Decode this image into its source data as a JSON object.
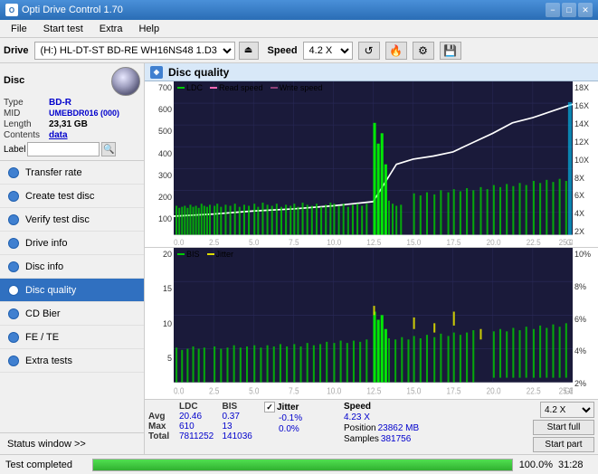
{
  "titleBar": {
    "title": "Opti Drive Control 1.70",
    "minimizeLabel": "−",
    "maximizeLabel": "□",
    "closeLabel": "✕"
  },
  "menuBar": {
    "items": [
      "File",
      "Start test",
      "Extra",
      "Help"
    ]
  },
  "driveBar": {
    "driveLabel": "Drive",
    "driveValue": "(H:) HL-DT-ST BD-RE  WH16NS48 1.D3",
    "speedLabel": "Speed",
    "speedValue": "4.2 X"
  },
  "discPanel": {
    "header": "Disc",
    "type": {
      "key": "Type",
      "val": "BD-R"
    },
    "mid": {
      "key": "MID",
      "val": "UMEBDR016 (000)"
    },
    "length": {
      "key": "Length",
      "val": "23,31 GB"
    },
    "contents": {
      "key": "Contents",
      "val": "data"
    },
    "labelKey": "Label"
  },
  "navItems": [
    {
      "id": "transfer-rate",
      "label": "Transfer rate",
      "active": false
    },
    {
      "id": "create-test-disc",
      "label": "Create test disc",
      "active": false
    },
    {
      "id": "verify-test-disc",
      "label": "Verify test disc",
      "active": false
    },
    {
      "id": "drive-info",
      "label": "Drive info",
      "active": false
    },
    {
      "id": "disc-info",
      "label": "Disc info",
      "active": false
    },
    {
      "id": "disc-quality",
      "label": "Disc quality",
      "active": true
    },
    {
      "id": "cd-bier",
      "label": "CD Bier",
      "active": false
    },
    {
      "id": "fe-te",
      "label": "FE / TE",
      "active": false
    },
    {
      "id": "extra-tests",
      "label": "Extra tests",
      "active": false
    }
  ],
  "statusWindow": "Status window >>",
  "discQuality": {
    "title": "Disc quality",
    "chart1": {
      "legend": [
        {
          "key": "ldc",
          "label": "LDC",
          "color": "#00aa00"
        },
        {
          "key": "readSpeed",
          "label": "Read speed",
          "color": "#ff69b4"
        },
        {
          "key": "writeSpeed",
          "label": "Write speed",
          "color": "#ff69b4"
        }
      ],
      "yLabels": [
        "700",
        "600",
        "500",
        "400",
        "300",
        "200",
        "100"
      ],
      "yLabelsRight": [
        "18X",
        "16X",
        "14X",
        "12X",
        "10X",
        "8X",
        "6X",
        "4X",
        "2X"
      ],
      "xLabels": [
        "0.0",
        "2.5",
        "5.0",
        "7.5",
        "10.0",
        "12.5",
        "15.0",
        "17.5",
        "20.0",
        "22.5",
        "25.0"
      ],
      "xUnit": "GB"
    },
    "chart2": {
      "legend": [
        {
          "key": "bis",
          "label": "BIS",
          "color": "#00aa00"
        },
        {
          "key": "jitter",
          "label": "Jitter",
          "color": "#dddd00"
        }
      ],
      "yLabels": [
        "20",
        "15",
        "10",
        "5"
      ],
      "yLabelsRight": [
        "10%",
        "8%",
        "6%",
        "4%",
        "2%"
      ],
      "xLabels": [
        "0.0",
        "2.5",
        "5.0",
        "7.5",
        "10.0",
        "12.5",
        "15.0",
        "17.5",
        "20.0",
        "22.5",
        "25.0"
      ],
      "xUnit": "GB"
    },
    "stats": {
      "headers": [
        "",
        "LDC",
        "BIS",
        "",
        "Jitter",
        "Speed",
        ""
      ],
      "avg": {
        "label": "Avg",
        "ldc": "20.46",
        "bis": "0.37",
        "jitter": "-0.1%",
        "speed": "4.23 X"
      },
      "max": {
        "label": "Max",
        "ldc": "610",
        "bis": "13",
        "jitter": "0.0%",
        "position": "23862 MB"
      },
      "total": {
        "label": "Total",
        "ldc": "7811252",
        "bis": "141036",
        "samples": "381756"
      },
      "jitterLabel": "Jitter",
      "speedLabel": "Speed",
      "speedVal": "4.23 X",
      "speedDropdown": "4.2 X",
      "positionLabel": "Position",
      "positionVal": "23862 MB",
      "samplesLabel": "Samples",
      "samplesVal": "381756",
      "startFull": "Start full",
      "startPart": "Start part"
    }
  },
  "progressBar": {
    "statusText": "Test completed",
    "percent": 100,
    "percentLabel": "100.0%",
    "time": "31:28"
  }
}
